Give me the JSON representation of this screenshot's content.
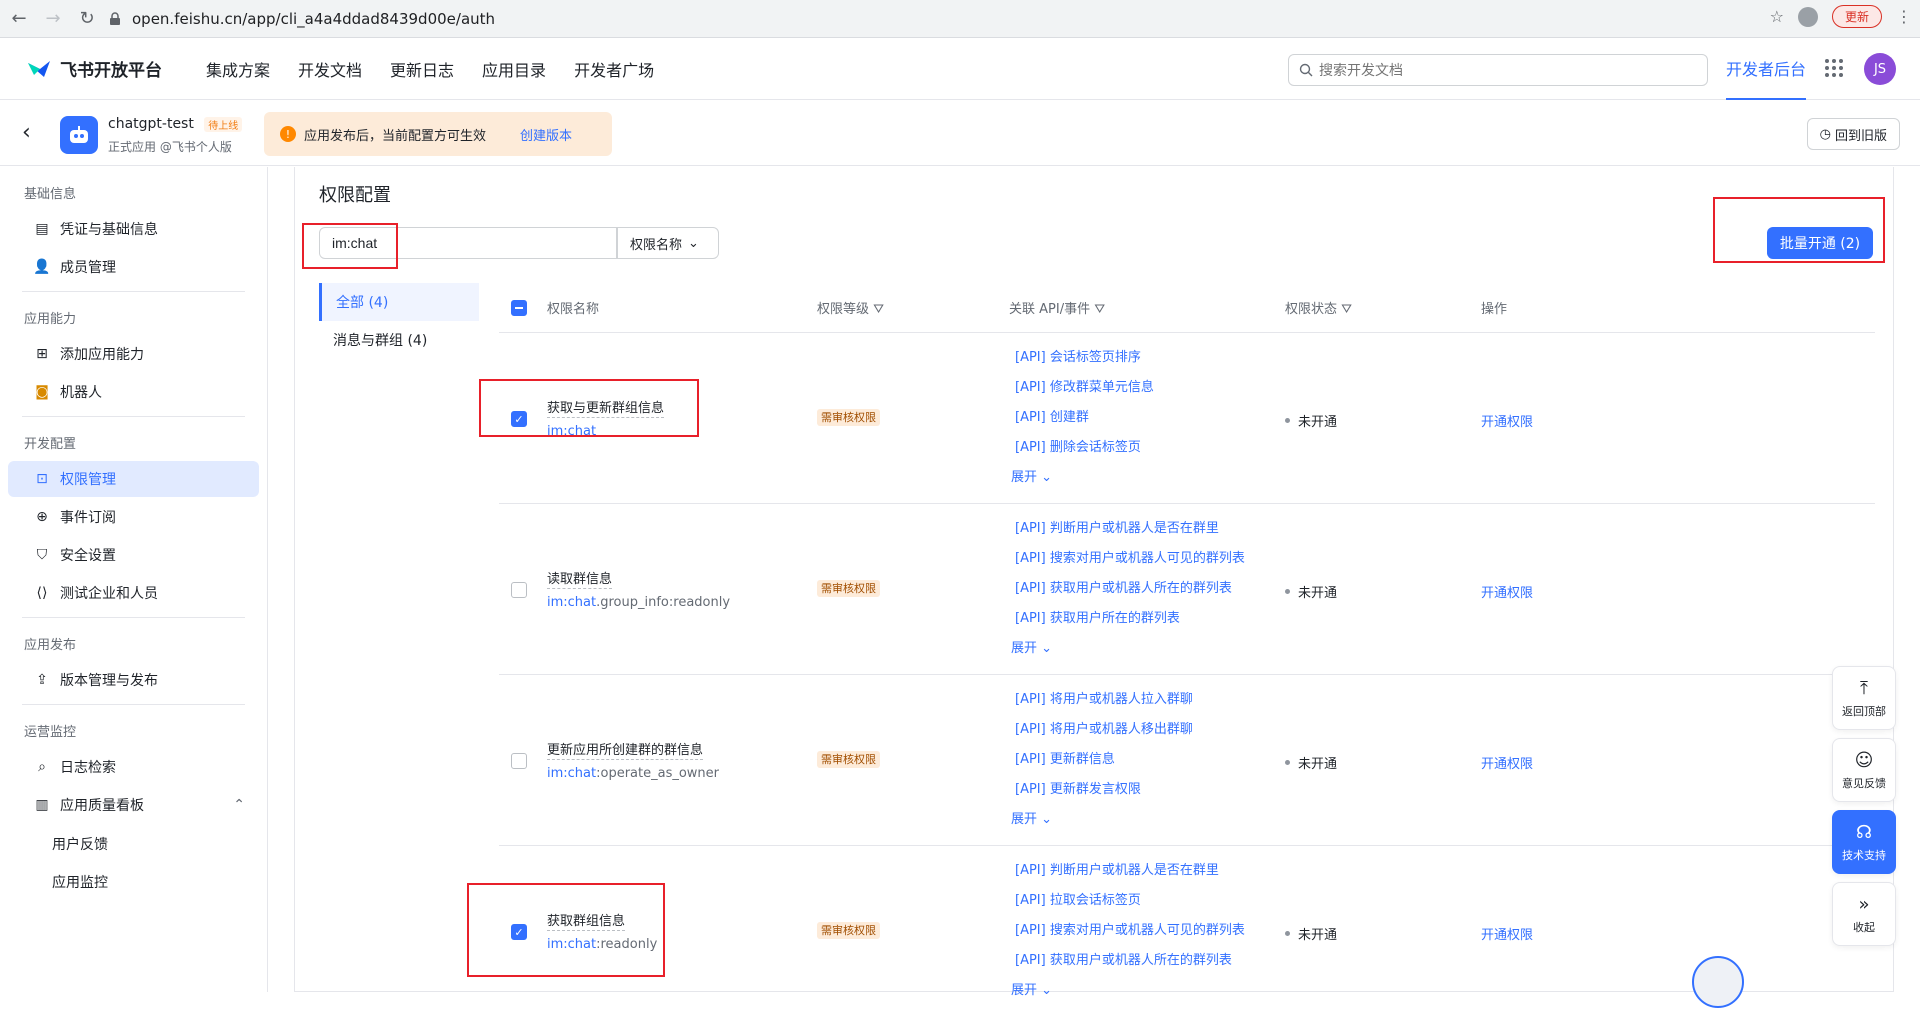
{
  "browser": {
    "url": "open.feishu.cn/app/cli_a4a4ddad8439d00e/auth",
    "update_label": "更新"
  },
  "header": {
    "logo_text": "飞书开放平台",
    "nav": [
      "集成方案",
      "开发文档",
      "更新日志",
      "应用目录",
      "开发者广场"
    ],
    "search_placeholder": "搜索开发文档",
    "dev_console": "开发者后台",
    "avatar_initials": "JS"
  },
  "app": {
    "name": "chatgpt-test",
    "badge": "待上线",
    "sub": "正式应用 @飞书个人版",
    "notice": "应用发布后，当前配置方可生效",
    "notice_link": "创建版本",
    "old_version": "回到旧版"
  },
  "sidebar": {
    "groups": [
      {
        "title": "基础信息",
        "items": [
          "凭证与基础信息",
          "成员管理"
        ]
      },
      {
        "title": "应用能力",
        "items": [
          "添加应用能力",
          "机器人"
        ]
      },
      {
        "title": "开发配置",
        "items": [
          "权限管理",
          "事件订阅",
          "安全设置",
          "测试企业和人员"
        ]
      },
      {
        "title": "应用发布",
        "items": [
          "版本管理与发布"
        ]
      },
      {
        "title": "运营监控",
        "items": [
          "日志检索",
          "应用质量看板"
        ]
      }
    ],
    "subitems": [
      "用户反馈",
      "应用监控"
    ],
    "active": "权限管理"
  },
  "main": {
    "title": "权限配置",
    "filter_value": "im:chat",
    "filter_select": "权限名称",
    "batch_button": "批量开通 (2)",
    "categories": [
      "全部 (4)",
      "消息与群组 (4)"
    ],
    "columns": [
      "权限名称",
      "权限等级",
      "关联 API/事件",
      "权限状态",
      "操作"
    ],
    "rows": [
      {
        "name": "获取与更新群组信息",
        "code_hl": "im:chat",
        "code_rest": "",
        "level": "需审核权限",
        "apis": [
          "[API] 会话标签页排序",
          "[API] 修改群菜单元信息",
          "[API] 创建群",
          "[API] 删除会话标签页"
        ],
        "expand": "展开",
        "status": "未开通",
        "op": "开通权限",
        "checked": true
      },
      {
        "name": "读取群信息",
        "code_hl": "im:chat",
        "code_rest": ".group_info:readonly",
        "level": "需审核权限",
        "apis": [
          "[API] 判断用户或机器人是否在群里",
          "[API] 搜索对用户或机器人可见的群列表",
          "[API] 获取用户或机器人所在的群列表",
          "[API] 获取用户所在的群列表"
        ],
        "expand": "展开",
        "status": "未开通",
        "op": "开通权限",
        "checked": false
      },
      {
        "name": "更新应用所创建群的群信息",
        "code_hl": "im:chat",
        "code_rest": ":operate_as_owner",
        "level": "需审核权限",
        "apis": [
          "[API] 将用户或机器人拉入群聊",
          "[API] 将用户或机器人移出群聊",
          "[API] 更新群信息",
          "[API] 更新群发言权限"
        ],
        "expand": "展开",
        "status": "未开通",
        "op": "开通权限",
        "checked": false
      },
      {
        "name": "获取群组信息",
        "code_hl": "im:chat",
        "code_rest": ":readonly",
        "level": "需审核权限",
        "apis": [
          "[API] 判断用户或机器人是否在群里",
          "[API] 拉取会话标签页",
          "[API] 搜索对用户或机器人可见的群列表",
          "[API] 获取用户或机器人所在的群列表"
        ],
        "expand": "展开",
        "status": "未开通",
        "op": "开通权限",
        "checked": true
      }
    ]
  },
  "float_buttons": [
    "返回顶部",
    "意见反馈",
    "技术支持",
    "收起"
  ],
  "colors": {
    "accent": "#3370ff",
    "highlight_box": "#e8202a",
    "tag_bg": "#fdebd9"
  }
}
